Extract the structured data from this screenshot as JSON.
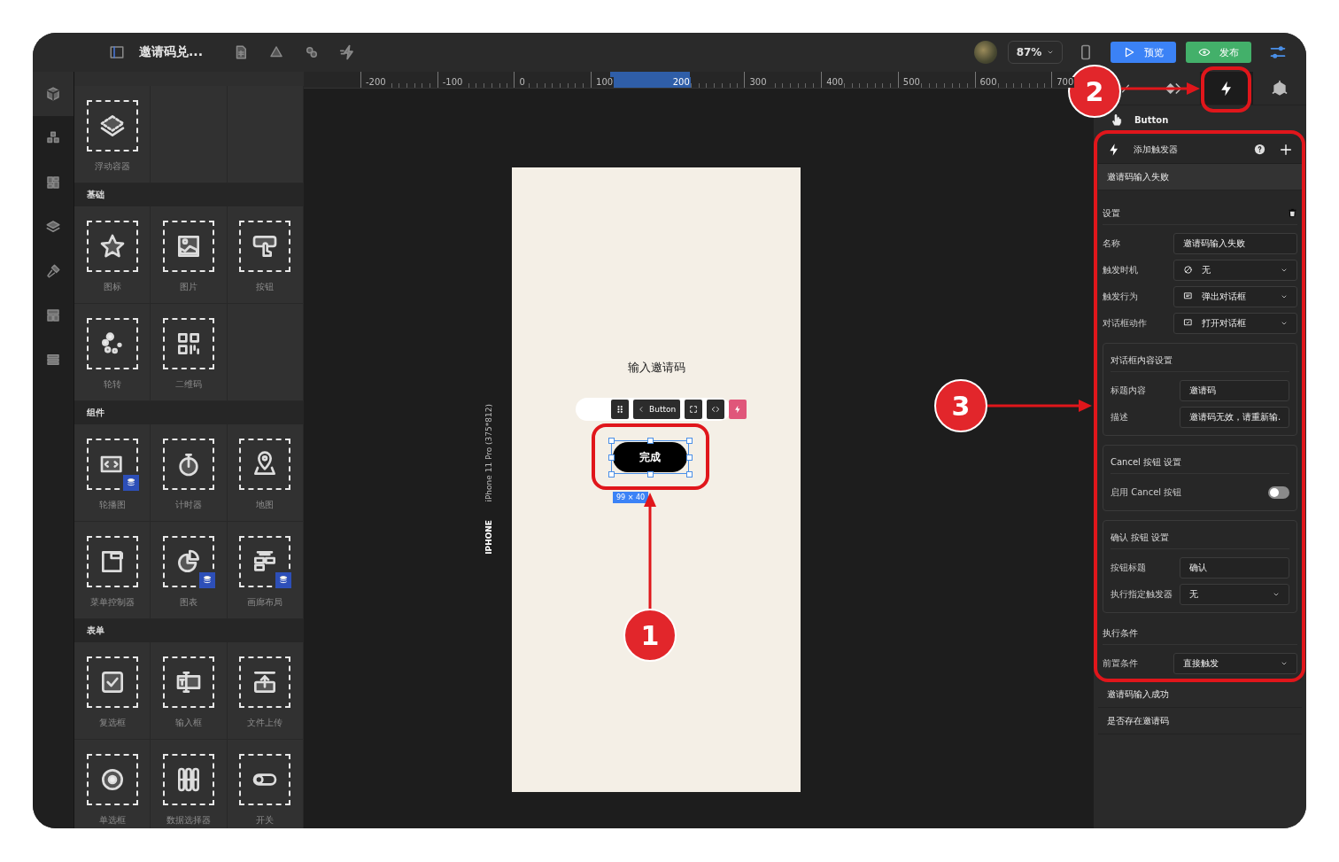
{
  "toolbar": {
    "title": "邀请码兑...",
    "zoom": "87%",
    "preview_button": "预览",
    "publish_button": "发布"
  },
  "rail": [
    {
      "selected": true
    },
    {
      "selected": false
    },
    {
      "selected": false
    },
    {
      "selected": false
    },
    {
      "selected": false
    },
    {
      "selected": false
    },
    {
      "selected": false
    }
  ],
  "components": {
    "sections": [
      {
        "items": [
          {
            "label": "浮动容器",
            "kind": "layers",
            "data_badge": false
          }
        ]
      },
      {
        "title": "基础",
        "items": [
          {
            "label": "图标",
            "kind": "star",
            "data_badge": false
          },
          {
            "label": "图片",
            "kind": "image",
            "data_badge": false
          },
          {
            "label": "按钮",
            "kind": "tap",
            "data_badge": false
          },
          {
            "label": "轮转",
            "kind": "spinner",
            "data_badge": false
          },
          {
            "label": "二维码",
            "kind": "qr",
            "data_badge": false
          }
        ]
      },
      {
        "title": "组件",
        "items": [
          {
            "label": "轮播图",
            "kind": "carousel",
            "data_badge": true
          },
          {
            "label": "计时器",
            "kind": "timer",
            "data_badge": false
          },
          {
            "label": "地图",
            "kind": "map",
            "data_badge": false
          },
          {
            "label": "菜单控制器",
            "kind": "menu",
            "data_badge": false
          },
          {
            "label": "图表",
            "kind": "chart",
            "data_badge": true
          },
          {
            "label": "画廊布局",
            "kind": "gallery",
            "data_badge": true
          }
        ]
      },
      {
        "title": "表单",
        "items": [
          {
            "label": "复选框",
            "kind": "checkbox",
            "data_badge": false
          },
          {
            "label": "输入框",
            "kind": "input",
            "data_badge": false
          },
          {
            "label": "文件上传",
            "kind": "upload",
            "data_badge": false
          },
          {
            "label": "单选框",
            "kind": "radio",
            "data_badge": false
          },
          {
            "label": "数据选择器",
            "kind": "picker",
            "data_badge": false
          },
          {
            "label": "开关",
            "kind": "toggle",
            "data_badge": false
          }
        ]
      }
    ]
  },
  "ruler": {
    "ticks": [
      {
        "label": "-200",
        "selected": false
      },
      {
        "label": "-100",
        "selected": false
      },
      {
        "label": "0",
        "selected": false
      },
      {
        "label": "100",
        "selected": false
      },
      {
        "label": "200",
        "selected": true
      },
      {
        "label": "300",
        "selected": false
      },
      {
        "label": "400",
        "selected": false
      },
      {
        "label": "500",
        "selected": false
      },
      {
        "label": "600",
        "selected": false
      },
      {
        "label": "700",
        "selected": false
      }
    ]
  },
  "canvas": {
    "device_label": "IPHONE",
    "device_model": "iPhone 11 Pro (375*812)",
    "page_title": "输入邀请码",
    "element_toolbar_label": "Button",
    "button": {
      "label": "完成",
      "selected": true
    },
    "size_badge": "99 × 40"
  },
  "inspector": {
    "tabs": [
      {
        "kind": "style",
        "selected": false
      },
      {
        "kind": "component",
        "selected": false
      },
      {
        "kind": "trigger",
        "selected": true
      },
      {
        "kind": "model",
        "selected": false
      }
    ],
    "element_name": "Button",
    "triggers_header": "添加触发器",
    "triggers": [
      {
        "name": "邀请码输入失败",
        "expanded": true
      },
      {
        "name": "邀请码输入成功",
        "expanded": false
      },
      {
        "name": "是否存在邀请码",
        "expanded": false
      }
    ],
    "groups": [
      {
        "title": "设置",
        "kind": "plain",
        "delete_icon": true,
        "fields": [
          {
            "label": "名称",
            "kind": "input",
            "value": "邀请码输入失败"
          },
          {
            "label": "触发时机",
            "kind": "select",
            "value": "无"
          },
          {
            "label": "触发行为",
            "kind": "select",
            "value": "弹出对话框"
          },
          {
            "label": "对话框动作",
            "kind": "select",
            "value": "打开对话框"
          }
        ]
      },
      {
        "title": "对话框内容设置",
        "kind": "box",
        "delete_icon": false,
        "fields": [
          {
            "label": "标题内容",
            "kind": "input",
            "value": "邀请码"
          },
          {
            "label": "描述",
            "kind": "input",
            "value": "邀请码无效，请重新输."
          }
        ]
      },
      {
        "title": "Cancel 按钮 设置",
        "kind": "box",
        "delete_icon": false,
        "fields": [
          {
            "label": "启用 Cancel 按钮",
            "kind": "toggle",
            "on": false
          }
        ]
      },
      {
        "title": "确认 按钮 设置",
        "kind": "box",
        "delete_icon": false,
        "fields": [
          {
            "label": "按钮标题",
            "kind": "input",
            "value": "确认"
          },
          {
            "label": "执行指定触发器",
            "kind": "select",
            "value": "无"
          }
        ]
      },
      {
        "title": "执行条件",
        "kind": "plain",
        "delete_icon": false,
        "fields": [
          {
            "label": "前置条件",
            "kind": "select",
            "value": "直接触发"
          }
        ]
      }
    ]
  },
  "annotations": [
    {
      "label": "1"
    },
    {
      "label": "2"
    },
    {
      "label": "3"
    }
  ]
}
